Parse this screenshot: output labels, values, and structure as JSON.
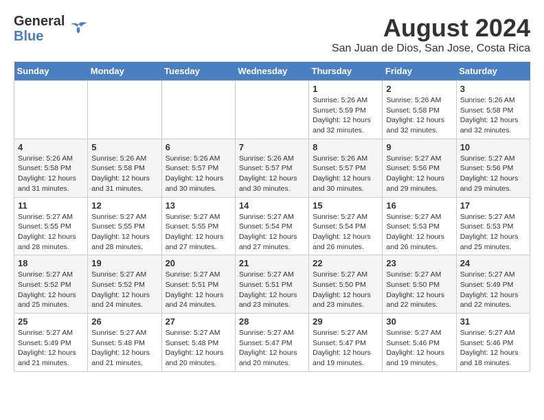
{
  "header": {
    "logo_line1": "General",
    "logo_line2": "Blue",
    "month_title": "August 2024",
    "location": "San Juan de Dios, San Jose, Costa Rica"
  },
  "days_of_week": [
    "Sunday",
    "Monday",
    "Tuesday",
    "Wednesday",
    "Thursday",
    "Friday",
    "Saturday"
  ],
  "weeks": [
    [
      {
        "day": "",
        "info": ""
      },
      {
        "day": "",
        "info": ""
      },
      {
        "day": "",
        "info": ""
      },
      {
        "day": "",
        "info": ""
      },
      {
        "day": "1",
        "info": "Sunrise: 5:26 AM\nSunset: 5:59 PM\nDaylight: 12 hours\nand 32 minutes."
      },
      {
        "day": "2",
        "info": "Sunrise: 5:26 AM\nSunset: 5:58 PM\nDaylight: 12 hours\nand 32 minutes."
      },
      {
        "day": "3",
        "info": "Sunrise: 5:26 AM\nSunset: 5:58 PM\nDaylight: 12 hours\nand 32 minutes."
      }
    ],
    [
      {
        "day": "4",
        "info": "Sunrise: 5:26 AM\nSunset: 5:58 PM\nDaylight: 12 hours\nand 31 minutes."
      },
      {
        "day": "5",
        "info": "Sunrise: 5:26 AM\nSunset: 5:58 PM\nDaylight: 12 hours\nand 31 minutes."
      },
      {
        "day": "6",
        "info": "Sunrise: 5:26 AM\nSunset: 5:57 PM\nDaylight: 12 hours\nand 30 minutes."
      },
      {
        "day": "7",
        "info": "Sunrise: 5:26 AM\nSunset: 5:57 PM\nDaylight: 12 hours\nand 30 minutes."
      },
      {
        "day": "8",
        "info": "Sunrise: 5:26 AM\nSunset: 5:57 PM\nDaylight: 12 hours\nand 30 minutes."
      },
      {
        "day": "9",
        "info": "Sunrise: 5:27 AM\nSunset: 5:56 PM\nDaylight: 12 hours\nand 29 minutes."
      },
      {
        "day": "10",
        "info": "Sunrise: 5:27 AM\nSunset: 5:56 PM\nDaylight: 12 hours\nand 29 minutes."
      }
    ],
    [
      {
        "day": "11",
        "info": "Sunrise: 5:27 AM\nSunset: 5:55 PM\nDaylight: 12 hours\nand 28 minutes."
      },
      {
        "day": "12",
        "info": "Sunrise: 5:27 AM\nSunset: 5:55 PM\nDaylight: 12 hours\nand 28 minutes."
      },
      {
        "day": "13",
        "info": "Sunrise: 5:27 AM\nSunset: 5:55 PM\nDaylight: 12 hours\nand 27 minutes."
      },
      {
        "day": "14",
        "info": "Sunrise: 5:27 AM\nSunset: 5:54 PM\nDaylight: 12 hours\nand 27 minutes."
      },
      {
        "day": "15",
        "info": "Sunrise: 5:27 AM\nSunset: 5:54 PM\nDaylight: 12 hours\nand 26 minutes."
      },
      {
        "day": "16",
        "info": "Sunrise: 5:27 AM\nSunset: 5:53 PM\nDaylight: 12 hours\nand 26 minutes."
      },
      {
        "day": "17",
        "info": "Sunrise: 5:27 AM\nSunset: 5:53 PM\nDaylight: 12 hours\nand 25 minutes."
      }
    ],
    [
      {
        "day": "18",
        "info": "Sunrise: 5:27 AM\nSunset: 5:52 PM\nDaylight: 12 hours\nand 25 minutes."
      },
      {
        "day": "19",
        "info": "Sunrise: 5:27 AM\nSunset: 5:52 PM\nDaylight: 12 hours\nand 24 minutes."
      },
      {
        "day": "20",
        "info": "Sunrise: 5:27 AM\nSunset: 5:51 PM\nDaylight: 12 hours\nand 24 minutes."
      },
      {
        "day": "21",
        "info": "Sunrise: 5:27 AM\nSunset: 5:51 PM\nDaylight: 12 hours\nand 23 minutes."
      },
      {
        "day": "22",
        "info": "Sunrise: 5:27 AM\nSunset: 5:50 PM\nDaylight: 12 hours\nand 23 minutes."
      },
      {
        "day": "23",
        "info": "Sunrise: 5:27 AM\nSunset: 5:50 PM\nDaylight: 12 hours\nand 22 minutes."
      },
      {
        "day": "24",
        "info": "Sunrise: 5:27 AM\nSunset: 5:49 PM\nDaylight: 12 hours\nand 22 minutes."
      }
    ],
    [
      {
        "day": "25",
        "info": "Sunrise: 5:27 AM\nSunset: 5:49 PM\nDaylight: 12 hours\nand 21 minutes."
      },
      {
        "day": "26",
        "info": "Sunrise: 5:27 AM\nSunset: 5:48 PM\nDaylight: 12 hours\nand 21 minutes."
      },
      {
        "day": "27",
        "info": "Sunrise: 5:27 AM\nSunset: 5:48 PM\nDaylight: 12 hours\nand 20 minutes."
      },
      {
        "day": "28",
        "info": "Sunrise: 5:27 AM\nSunset: 5:47 PM\nDaylight: 12 hours\nand 20 minutes."
      },
      {
        "day": "29",
        "info": "Sunrise: 5:27 AM\nSunset: 5:47 PM\nDaylight: 12 hours\nand 19 minutes."
      },
      {
        "day": "30",
        "info": "Sunrise: 5:27 AM\nSunset: 5:46 PM\nDaylight: 12 hours\nand 19 minutes."
      },
      {
        "day": "31",
        "info": "Sunrise: 5:27 AM\nSunset: 5:46 PM\nDaylight: 12 hours\nand 18 minutes."
      }
    ]
  ]
}
